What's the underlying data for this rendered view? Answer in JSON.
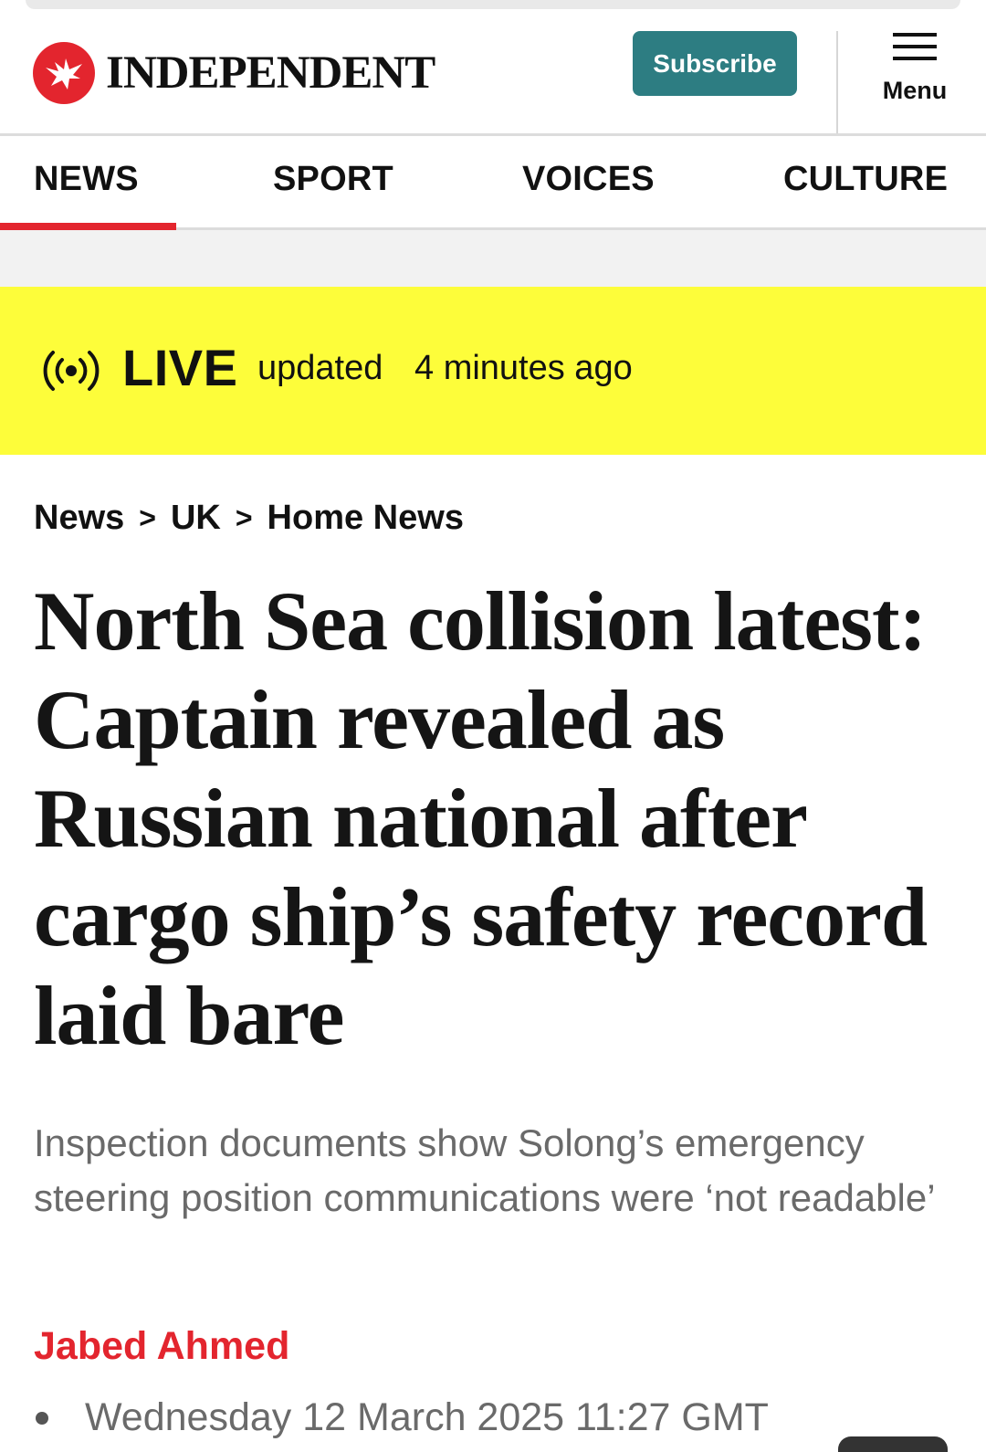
{
  "masthead": {
    "brand": "INDEPENDENT",
    "subscribe_label": "Subscribe",
    "menu_label": "Menu"
  },
  "nav": {
    "items": [
      "NEWS",
      "SPORT",
      "VOICES",
      "CULTURE"
    ],
    "active": "NEWS"
  },
  "live": {
    "label": "LIVE",
    "updated": "updated",
    "time_ago": "4 minutes ago"
  },
  "breadcrumb": [
    "News",
    "UK",
    "Home News"
  ],
  "breadcrumb_separator": ">",
  "article": {
    "headline": "North Sea collision latest: Captain revealed as Russian national after cargo ship’s safety record laid bare",
    "standfirst": "Inspection documents show Solong’s emergency steering position communications were ‘not readable’",
    "author": "Jabed Ahmed",
    "date": "Wednesday 12 March 2025 11:27 GMT"
  },
  "colors": {
    "brand_red": "#e3252e",
    "subscribe_teal": "#2d7d82",
    "live_yellow": "#fdfd3a",
    "standfirst_grey": "#6a6a6a"
  },
  "icons": {
    "logo": "eagle-icon",
    "menu": "hamburger-icon",
    "live": "broadcast-icon"
  }
}
